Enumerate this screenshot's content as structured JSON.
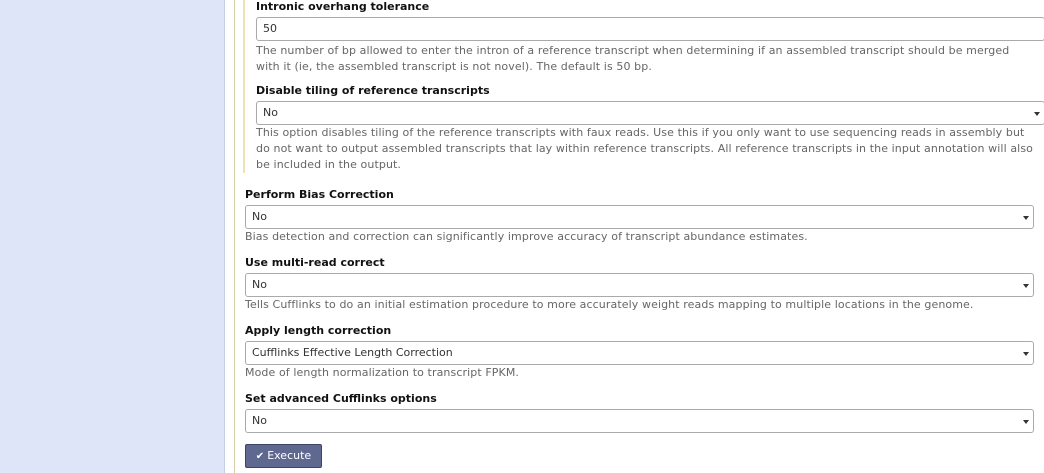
{
  "form": {
    "overhang": {
      "label": "Intronic overhang tolerance",
      "value": "50",
      "help": "The number of bp allowed to enter the intron of a reference transcript when determining if an assembled transcript should be merged with it (ie, the assembled transcript is not novel). The default is 50 bp."
    },
    "tiling": {
      "label": "Disable tiling of reference transcripts",
      "value": "No",
      "help": "This option disables tiling of the reference transcripts with faux reads. Use this if you only want to use sequencing reads in assembly but do not want to output assembled transcripts that lay within reference transcripts. All reference transcripts in the input annotation will also be included in the output."
    },
    "bias": {
      "label": "Perform Bias Correction",
      "value": "No",
      "help": "Bias detection and correction can significantly improve accuracy of transcript abundance estimates."
    },
    "multiread": {
      "label": "Use multi-read correct",
      "value": "No",
      "help": "Tells Cufflinks to do an initial estimation procedure to more accurately weight reads mapping to multiple locations in the genome."
    },
    "length": {
      "label": "Apply length correction",
      "value": "Cufflinks Effective Length Correction",
      "help": "Mode of length normalization to transcript FPKM."
    },
    "advanced": {
      "label": "Set advanced Cufflinks options",
      "value": "No"
    },
    "execute_label": "Execute"
  },
  "icons": {
    "execute": "check-icon",
    "select": "caret-down-icon"
  },
  "colors": {
    "left_panel": "#dfe5f9",
    "button": "#5f6990",
    "nested_border": "#efe2b6"
  }
}
